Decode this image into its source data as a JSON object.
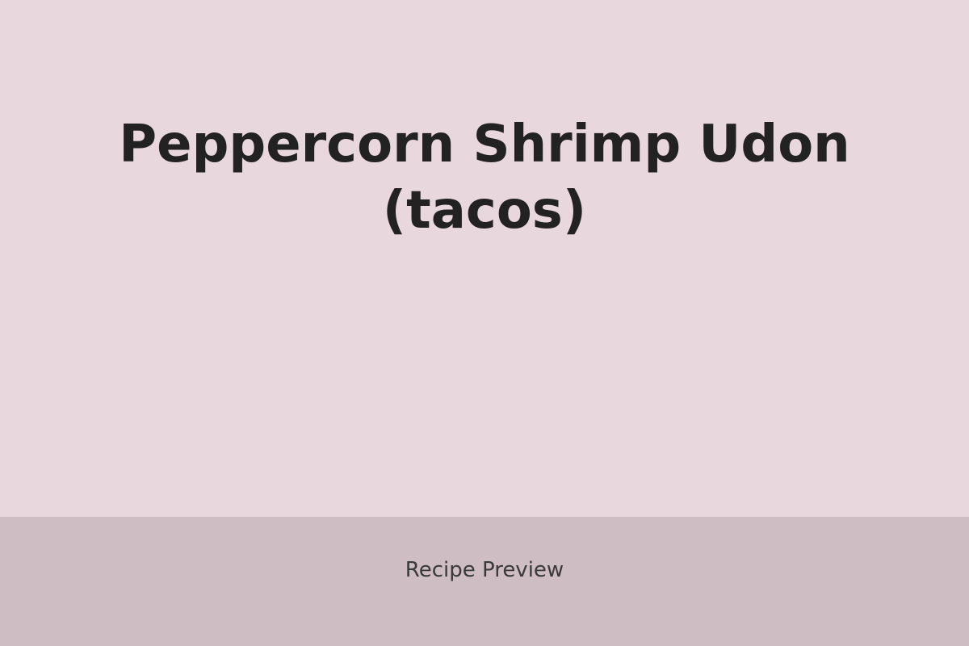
{
  "recipe": {
    "title_line1": "Peppercorn Shrimp Udon",
    "title_line2": "(tacos)"
  },
  "footer": {
    "label": "Recipe Preview"
  },
  "colors": {
    "background": "#e8d7dc",
    "footer_background": "#cebdc3",
    "title_text": "#222222",
    "footer_text": "#3a3a3a"
  }
}
